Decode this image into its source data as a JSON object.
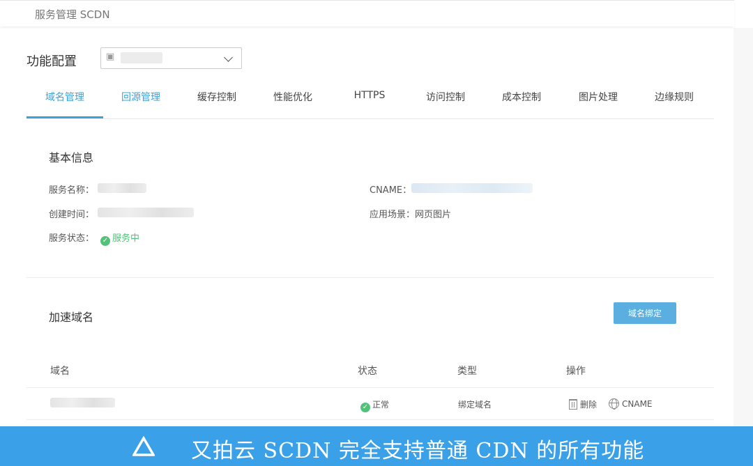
{
  "header": {
    "title": "服务管理 SCDN"
  },
  "config": {
    "label": "功能配置",
    "select_icon": "service-icon"
  },
  "tabs": [
    {
      "label": "域名管理",
      "active": true
    },
    {
      "label": "回源管理"
    },
    {
      "label": "缓存控制"
    },
    {
      "label": "性能优化"
    },
    {
      "label": "HTTPS"
    },
    {
      "label": "访问控制"
    },
    {
      "label": "成本控制"
    },
    {
      "label": "图片处理"
    },
    {
      "label": "边缘规则"
    }
  ],
  "basic": {
    "title": "基本信息",
    "service_name_label": "服务名称：",
    "created_label": "创建时间：",
    "status_label": "服务状态：",
    "status_value": "服务中",
    "cname_label": "CNAME：",
    "scene_label": "应用场景：",
    "scene_value": "网页图片"
  },
  "domains": {
    "title": "加速域名",
    "bind_button": "域名绑定",
    "columns": [
      "域名",
      "状态",
      "类型",
      "操作"
    ],
    "rows": [
      {
        "status": "正常",
        "type": "绑定域名",
        "delete": "删除",
        "cname": "CNAME"
      }
    ]
  },
  "banner": {
    "text": "又拍云 SCDN 完全支持普通 CDN 的所有功能"
  },
  "colors": {
    "accent": "#3da1d8",
    "ok": "#52c27a",
    "banner": "#3aa0e8"
  }
}
